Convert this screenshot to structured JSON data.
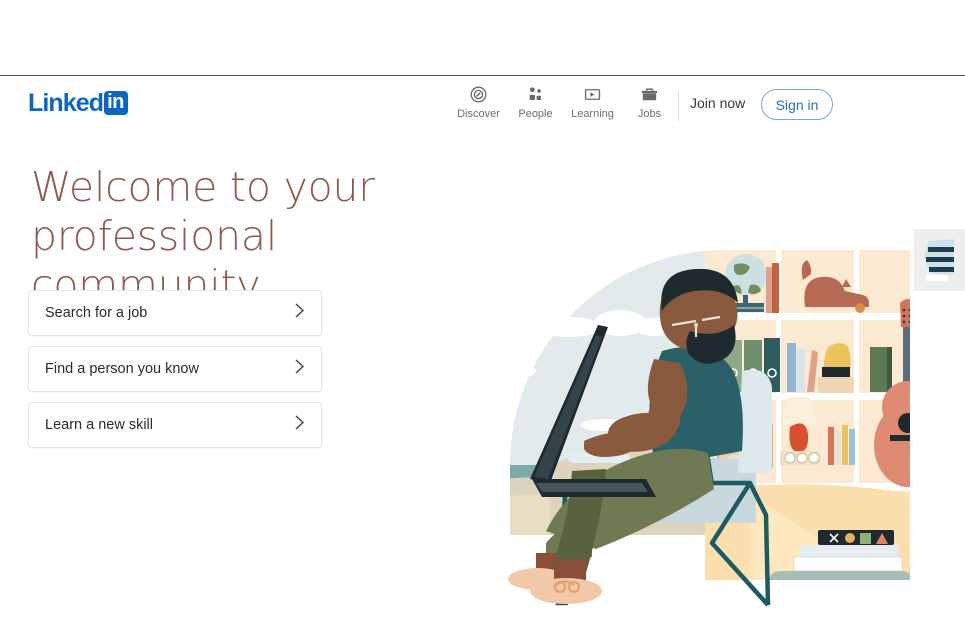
{
  "brand": {
    "logo_word": "Linked",
    "logo_badge": "in",
    "logo_color": "#0a66c2"
  },
  "header": {
    "nav": [
      {
        "label": "Discover",
        "icon": "compass-icon"
      },
      {
        "label": "People",
        "icon": "people-icon"
      },
      {
        "label": "Learning",
        "icon": "learning-icon"
      },
      {
        "label": "Jobs",
        "icon": "briefcase-icon"
      }
    ],
    "join_now": "Join now",
    "sign_in": "Sign in",
    "sign_in_color": "#2e6fb5"
  },
  "hero": {
    "headline_line1": "Welcome to your",
    "headline_line2": "professional community",
    "headline_color": "#8d5b4d",
    "cards": [
      {
        "label": "Search for a job",
        "chevron": "chevron-right-icon"
      },
      {
        "label": "Find a person you know",
        "chevron": "chevron-right-icon"
      },
      {
        "label": "Learn a new skill",
        "chevron": "chevron-right-icon"
      }
    ]
  },
  "illustration": {
    "name": "person-working-on-laptop-illustration",
    "alt": "Person with beard and glasses sitting in a chair using a laptop, bookshelf with globe, cat, binders, vase, guitar, lamp and books behind"
  },
  "widget": {
    "name": "floating-badge-widget"
  }
}
